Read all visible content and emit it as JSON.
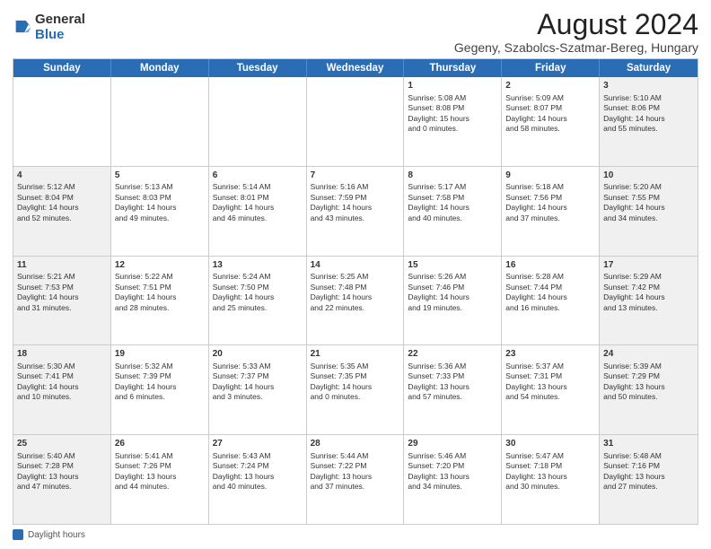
{
  "logo": {
    "general": "General",
    "blue": "Blue"
  },
  "title": "August 2024",
  "subtitle": "Gegeny, Szabolcs-Szatmar-Bereg, Hungary",
  "header_days": [
    "Sunday",
    "Monday",
    "Tuesday",
    "Wednesday",
    "Thursday",
    "Friday",
    "Saturday"
  ],
  "footer_label": "Daylight hours",
  "weeks": [
    [
      {
        "day": "",
        "info": ""
      },
      {
        "day": "",
        "info": ""
      },
      {
        "day": "",
        "info": ""
      },
      {
        "day": "",
        "info": ""
      },
      {
        "day": "1",
        "info": "Sunrise: 5:08 AM\nSunset: 8:08 PM\nDaylight: 15 hours\nand 0 minutes."
      },
      {
        "day": "2",
        "info": "Sunrise: 5:09 AM\nSunset: 8:07 PM\nDaylight: 14 hours\nand 58 minutes."
      },
      {
        "day": "3",
        "info": "Sunrise: 5:10 AM\nSunset: 8:06 PM\nDaylight: 14 hours\nand 55 minutes."
      }
    ],
    [
      {
        "day": "4",
        "info": "Sunrise: 5:12 AM\nSunset: 8:04 PM\nDaylight: 14 hours\nand 52 minutes."
      },
      {
        "day": "5",
        "info": "Sunrise: 5:13 AM\nSunset: 8:03 PM\nDaylight: 14 hours\nand 49 minutes."
      },
      {
        "day": "6",
        "info": "Sunrise: 5:14 AM\nSunset: 8:01 PM\nDaylight: 14 hours\nand 46 minutes."
      },
      {
        "day": "7",
        "info": "Sunrise: 5:16 AM\nSunset: 7:59 PM\nDaylight: 14 hours\nand 43 minutes."
      },
      {
        "day": "8",
        "info": "Sunrise: 5:17 AM\nSunset: 7:58 PM\nDaylight: 14 hours\nand 40 minutes."
      },
      {
        "day": "9",
        "info": "Sunrise: 5:18 AM\nSunset: 7:56 PM\nDaylight: 14 hours\nand 37 minutes."
      },
      {
        "day": "10",
        "info": "Sunrise: 5:20 AM\nSunset: 7:55 PM\nDaylight: 14 hours\nand 34 minutes."
      }
    ],
    [
      {
        "day": "11",
        "info": "Sunrise: 5:21 AM\nSunset: 7:53 PM\nDaylight: 14 hours\nand 31 minutes."
      },
      {
        "day": "12",
        "info": "Sunrise: 5:22 AM\nSunset: 7:51 PM\nDaylight: 14 hours\nand 28 minutes."
      },
      {
        "day": "13",
        "info": "Sunrise: 5:24 AM\nSunset: 7:50 PM\nDaylight: 14 hours\nand 25 minutes."
      },
      {
        "day": "14",
        "info": "Sunrise: 5:25 AM\nSunset: 7:48 PM\nDaylight: 14 hours\nand 22 minutes."
      },
      {
        "day": "15",
        "info": "Sunrise: 5:26 AM\nSunset: 7:46 PM\nDaylight: 14 hours\nand 19 minutes."
      },
      {
        "day": "16",
        "info": "Sunrise: 5:28 AM\nSunset: 7:44 PM\nDaylight: 14 hours\nand 16 minutes."
      },
      {
        "day": "17",
        "info": "Sunrise: 5:29 AM\nSunset: 7:42 PM\nDaylight: 14 hours\nand 13 minutes."
      }
    ],
    [
      {
        "day": "18",
        "info": "Sunrise: 5:30 AM\nSunset: 7:41 PM\nDaylight: 14 hours\nand 10 minutes."
      },
      {
        "day": "19",
        "info": "Sunrise: 5:32 AM\nSunset: 7:39 PM\nDaylight: 14 hours\nand 6 minutes."
      },
      {
        "day": "20",
        "info": "Sunrise: 5:33 AM\nSunset: 7:37 PM\nDaylight: 14 hours\nand 3 minutes."
      },
      {
        "day": "21",
        "info": "Sunrise: 5:35 AM\nSunset: 7:35 PM\nDaylight: 14 hours\nand 0 minutes."
      },
      {
        "day": "22",
        "info": "Sunrise: 5:36 AM\nSunset: 7:33 PM\nDaylight: 13 hours\nand 57 minutes."
      },
      {
        "day": "23",
        "info": "Sunrise: 5:37 AM\nSunset: 7:31 PM\nDaylight: 13 hours\nand 54 minutes."
      },
      {
        "day": "24",
        "info": "Sunrise: 5:39 AM\nSunset: 7:29 PM\nDaylight: 13 hours\nand 50 minutes."
      }
    ],
    [
      {
        "day": "25",
        "info": "Sunrise: 5:40 AM\nSunset: 7:28 PM\nDaylight: 13 hours\nand 47 minutes."
      },
      {
        "day": "26",
        "info": "Sunrise: 5:41 AM\nSunset: 7:26 PM\nDaylight: 13 hours\nand 44 minutes."
      },
      {
        "day": "27",
        "info": "Sunrise: 5:43 AM\nSunset: 7:24 PM\nDaylight: 13 hours\nand 40 minutes."
      },
      {
        "day": "28",
        "info": "Sunrise: 5:44 AM\nSunset: 7:22 PM\nDaylight: 13 hours\nand 37 minutes."
      },
      {
        "day": "29",
        "info": "Sunrise: 5:46 AM\nSunset: 7:20 PM\nDaylight: 13 hours\nand 34 minutes."
      },
      {
        "day": "30",
        "info": "Sunrise: 5:47 AM\nSunset: 7:18 PM\nDaylight: 13 hours\nand 30 minutes."
      },
      {
        "day": "31",
        "info": "Sunrise: 5:48 AM\nSunset: 7:16 PM\nDaylight: 13 hours\nand 27 minutes."
      }
    ]
  ]
}
